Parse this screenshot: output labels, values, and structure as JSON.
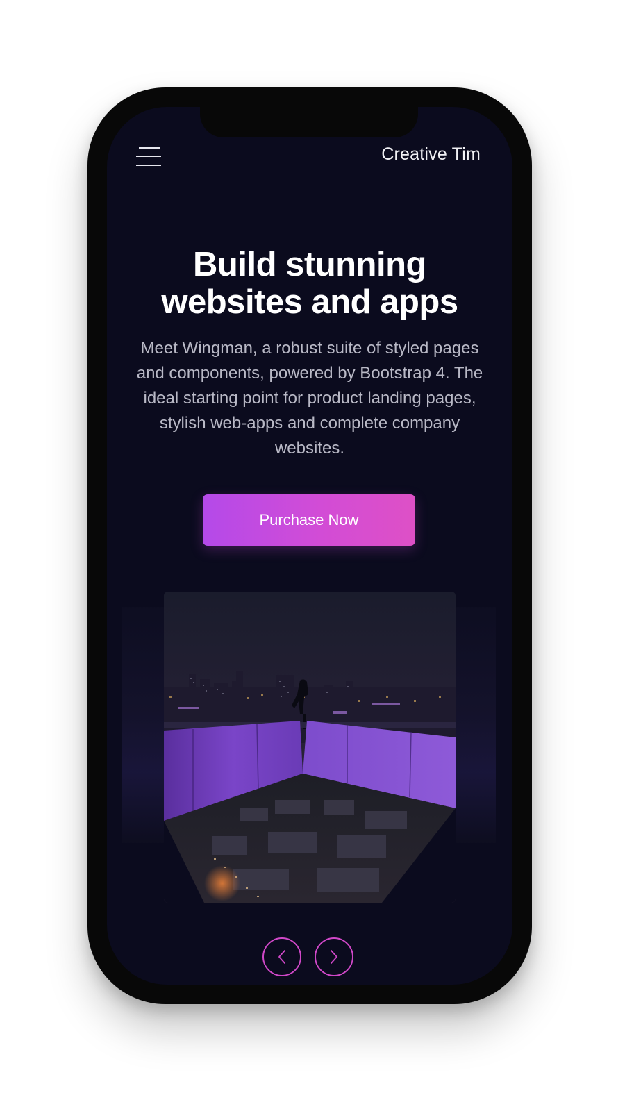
{
  "navbar": {
    "menu_icon": "hamburger-menu-icon",
    "brand": "Creative Tim"
  },
  "hero": {
    "title_line1": "Build stunning",
    "title_line2": "websites and apps",
    "description": "Meet Wingman, a robust suite of styled pages and components, powered by Bootstrap 4. The ideal starting point for product landing pages, stylish web-apps and complete company websites.",
    "cta_label": "Purchase Now"
  },
  "carousel": {
    "image_subject": "night-city-rooftop-photo",
    "prev_icon": "chevron-left-icon",
    "next_icon": "chevron-right-icon"
  },
  "colors": {
    "screen_background": "#0b0b1e",
    "accent_start": "#b44ae9",
    "accent_end": "#de50c6",
    "arrow_border": "#d048c8"
  }
}
